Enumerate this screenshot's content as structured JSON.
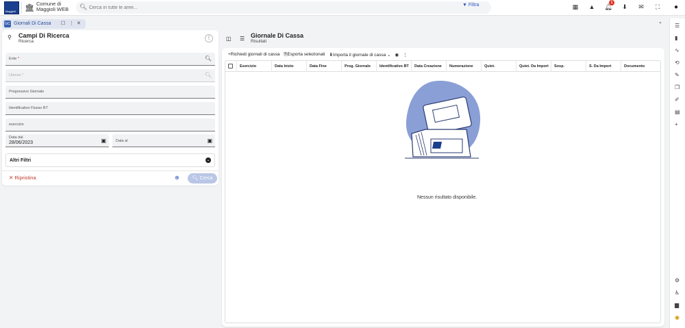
{
  "topbar": {
    "municipality_line1": "Comune di",
    "municipality_line2": "Maggioli WEB",
    "search_placeholder": "Cerca in tutte le aree...",
    "filter_label": "Filtra",
    "notification_count": "1"
  },
  "tabs": [
    {
      "label": "Giornali Di Cassa",
      "badge": "GC"
    }
  ],
  "left_panel": {
    "title": "Campi Di Ricerca",
    "subtitle": "Ricerca",
    "fields": {
      "ente": "Ente",
      "utenza": "Utenza",
      "progressivo": "Progressivo Giornale",
      "flusso": "Identificativo Flusso BT",
      "esercizio": "esercizio",
      "data_dal_label": "Data dal",
      "data_dal_value": "28/06/2023",
      "data_al_label": "Data al"
    },
    "altri_filtri": "Altri Filtri",
    "reset_label": "Ripristina",
    "search_label": "Cerca"
  },
  "right_panel": {
    "title": "Giornale Di Cassa",
    "subtitle": "Risultati",
    "toolbar": {
      "richiedi": "Richiedi giornali di cassa",
      "esporta": "Esporta selezionati",
      "importa": "Importa il giornale di cassa"
    },
    "columns": [
      "Esercizio",
      "Data Inizio",
      "Data Fine",
      "Prog. Giornale",
      "Identificativo BT",
      "Data Creazione",
      "Numerazione",
      "Quiet.",
      "Quiet. Da Import",
      "Sosp.",
      "S. Da Import",
      "Documento"
    ],
    "empty_message": "Nessun risultato disponibile."
  }
}
